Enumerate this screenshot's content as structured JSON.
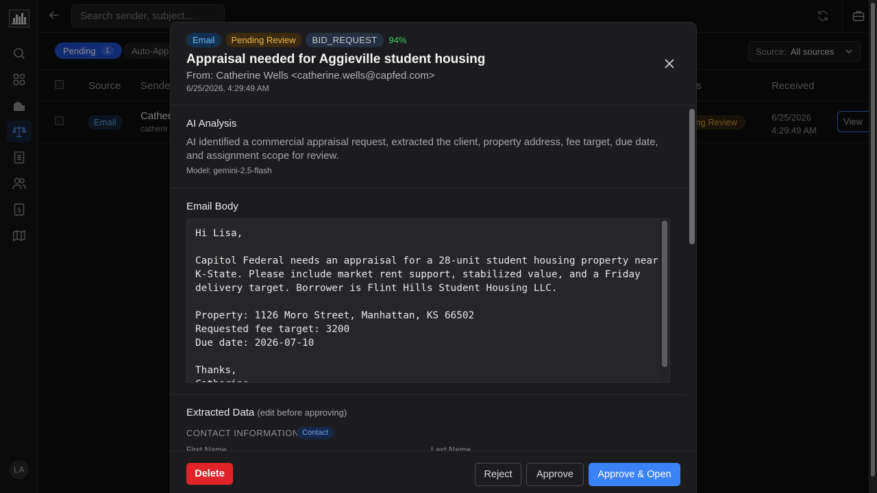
{
  "search": {
    "placeholder": "Search sender, subject..."
  },
  "filters": {
    "pending_label": "Pending",
    "pending_count": "1",
    "auto_label": "Auto-App",
    "source_label": "Source:",
    "source_value": "All sources"
  },
  "table": {
    "headers": {
      "source": "Source",
      "sender": "Sende",
      "status": "us",
      "received": "Received"
    },
    "row": {
      "source": "Email",
      "sender_name": "Cather",
      "sender_email": "catherir",
      "status": "nding Review",
      "received_date": "6/25/2026",
      "received_time": "4:29:49 AM",
      "view": "View"
    }
  },
  "user": {
    "initials": "LA"
  },
  "modal": {
    "badges": {
      "source": "Email",
      "status": "Pending Review",
      "type": "BID_REQUEST",
      "confidence": "94%"
    },
    "title": "Appraisal needed for Aggieville student housing",
    "from": "From: Catherine Wells <catherine.wells@capfed.com>",
    "date": "6/25/2026, 4:29:49 AM",
    "ai": {
      "title": "AI Analysis",
      "text": "AI identified a commercial appraisal request, extracted the client, property address, fee target, due date, and assignment scope for review.",
      "model": "Model: gemini-2.5-flash"
    },
    "email_body": {
      "title": "Email Body",
      "text": "Hi Lisa,\n\nCapitol Federal needs an appraisal for a 28-unit student housing property near\nK-State. Please include market rent support, stabilized value, and a Friday\ndelivery target. Borrower is Flint Hills Student Housing LLC.\n\nProperty: 1126 Moro Street, Manhattan, KS 66502\nRequested fee target: 3200\nDue date: 2026-07-10\n\nThanks,\nCatherine"
    },
    "extracted": {
      "title": "Extracted Data",
      "subtitle": "(edit before approving)",
      "contact_label": "CONTACT INFORMATION",
      "contact_badge": "Contact",
      "first_name_label": "First Name",
      "last_name_label": "Last Name"
    },
    "actions": {
      "delete": "Delete",
      "reject": "Reject",
      "approve": "Approve",
      "approve_open": "Approve & Open"
    }
  },
  "colors": {
    "accent": "#3b82f6",
    "danger": "#e0252a",
    "pending": "#f1b54a",
    "success": "#3fcf6a"
  }
}
